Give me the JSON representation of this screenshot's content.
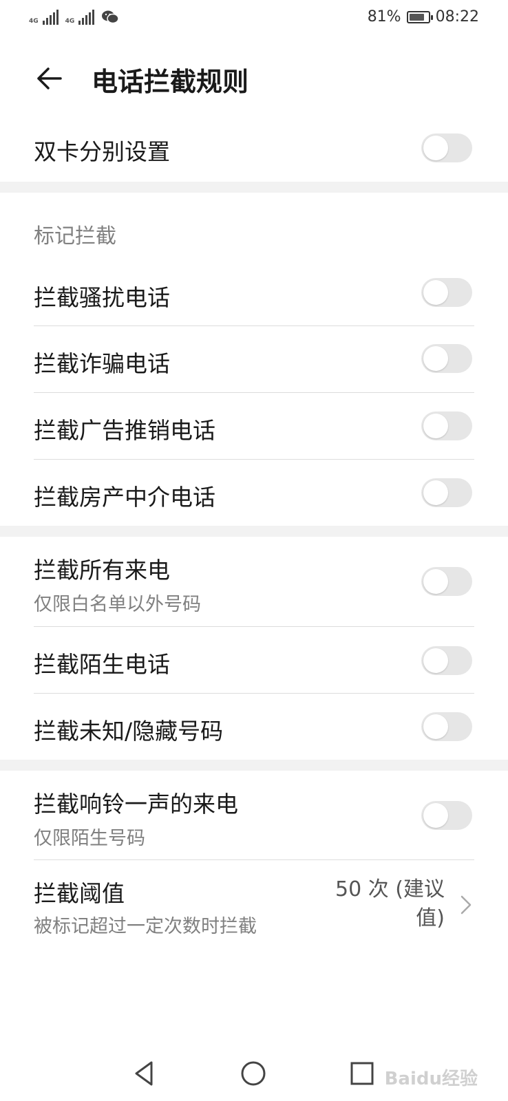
{
  "status_bar": {
    "sim1_tag": "4G",
    "sim2_tag": "4G",
    "battery_percent": "81%",
    "battery_level": 0.81,
    "time": "08:22"
  },
  "header": {
    "title": "电话拦截规则"
  },
  "dual_sim": {
    "label": "双卡分别设置",
    "enabled": false
  },
  "mark_section": {
    "title": "标记拦截",
    "items": [
      {
        "label": "拦截骚扰电话",
        "enabled": false
      },
      {
        "label": "拦截诈骗电话",
        "enabled": false
      },
      {
        "label": "拦截广告推销电话",
        "enabled": false
      },
      {
        "label": "拦截房产中介电话",
        "enabled": false
      }
    ]
  },
  "all_calls": {
    "label": "拦截所有来电",
    "sub": "仅限白名单以外号码",
    "enabled": false
  },
  "stranger": {
    "label": "拦截陌生电话",
    "enabled": false
  },
  "unknown": {
    "label": "拦截未知/隐藏号码",
    "enabled": false
  },
  "ring_once": {
    "label": "拦截响铃一声的来电",
    "sub": "仅限陌生号码",
    "enabled": false
  },
  "threshold": {
    "label": "拦截阈值",
    "sub": "被标记超过一定次数时拦截",
    "value_line1": "50 次 (建议",
    "value_line2": "值)"
  },
  "watermark": "Baidu经验",
  "colors": {
    "toggle_off": "#e6e6e6",
    "band": "#f2f2f2",
    "secondary_text": "#808080"
  }
}
